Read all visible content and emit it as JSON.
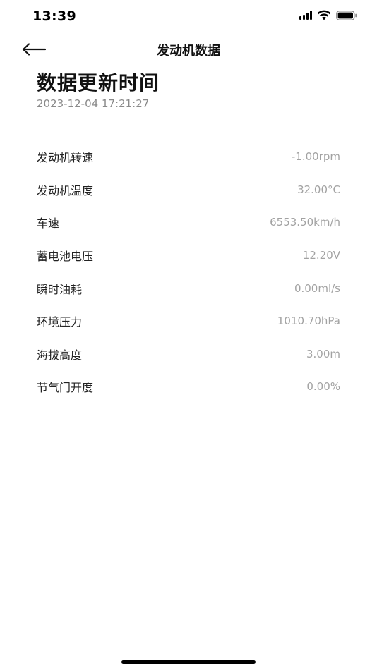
{
  "status_bar": {
    "time": "13:39",
    "signal_icon": "cellular-signal-icon",
    "wifi_icon": "wifi-icon",
    "battery_icon": "battery-icon"
  },
  "nav": {
    "back_icon": "arrow-left-icon",
    "title": "发动机数据"
  },
  "header": {
    "title": "数据更新时间",
    "timestamp": "2023-12-04 17:21:27"
  },
  "rows": [
    {
      "label": "发动机转速",
      "value": "-1.00rpm"
    },
    {
      "label": "发动机温度",
      "value": "32.00°C"
    },
    {
      "label": "车速",
      "value": "6553.50km/h"
    },
    {
      "label": "蓄电池电压",
      "value": "12.20V"
    },
    {
      "label": "瞬时油耗",
      "value": "0.00ml/s"
    },
    {
      "label": "环境压力",
      "value": "1010.70hPa"
    },
    {
      "label": "海拔高度",
      "value": "3.00m"
    },
    {
      "label": "节气门开度",
      "value": "0.00%"
    }
  ],
  "colors": {
    "label": "#222222",
    "value": "#a2a2a2",
    "timestamp": "#8a8a8a",
    "background": "#ffffff"
  }
}
